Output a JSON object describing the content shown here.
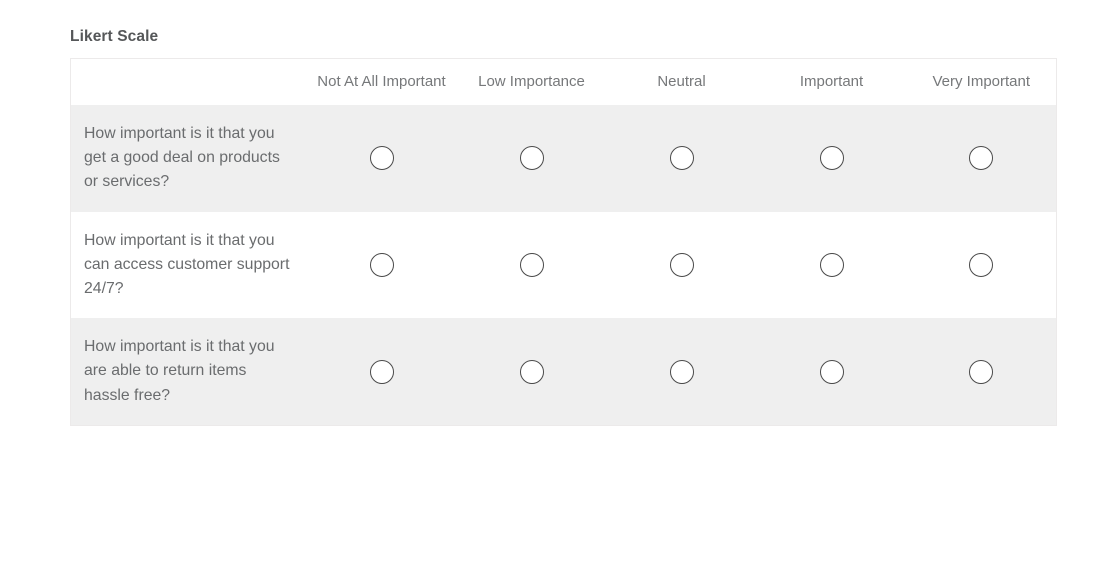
{
  "widget": {
    "title": "Likert Scale",
    "colors": {
      "title_text": "#555759",
      "header_text": "#76787a",
      "question_text": "#6a6c6e",
      "row_shaded_bg": "#efefef",
      "row_plain_bg": "#ffffff",
      "table_border": "#eceaea",
      "radio_border": "#4a4a4a",
      "page_bg": "#ffffff"
    },
    "table": {
      "row_header_label": "",
      "columns": [
        {
          "label": "Not At All Important",
          "name": "not-at-all-important"
        },
        {
          "label": "Low Importance",
          "name": "low-importance"
        },
        {
          "label": "Neutral",
          "name": "neutral"
        },
        {
          "label": "Important",
          "name": "important"
        },
        {
          "label": "Very Important",
          "name": "very-important"
        }
      ],
      "rows": [
        {
          "question": "How important is it that you get a good deal on products or services?",
          "shaded": true,
          "selected": null
        },
        {
          "question": "How important is it that you can access customer support 24/7?",
          "shaded": false,
          "selected": null
        },
        {
          "question": "How important is it that you are able to return items hassle free?",
          "shaded": true,
          "selected": null
        }
      ]
    }
  }
}
